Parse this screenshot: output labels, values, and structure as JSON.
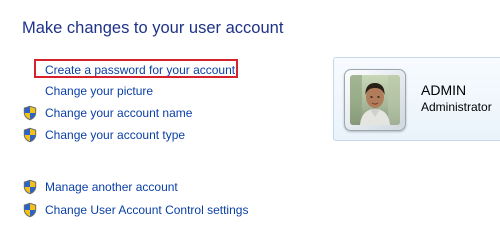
{
  "page": {
    "title": "Make changes to your user account"
  },
  "tasks": [
    {
      "label": "Create a password for your account",
      "icon": "none",
      "highlighted": true
    },
    {
      "label": "Change your picture",
      "icon": "none"
    },
    {
      "label": "Change your account name",
      "icon": "uac-shield-icon"
    },
    {
      "label": "Change your account type",
      "icon": "uac-shield-icon"
    },
    {
      "label": "Manage another account",
      "icon": "uac-shield-icon"
    },
    {
      "label": "Change User Account Control settings",
      "icon": "uac-shield-icon"
    }
  ],
  "account": {
    "name": "ADMIN",
    "type": "Administrator"
  },
  "colors": {
    "title": "#1e3287",
    "link": "#0a3fa6",
    "highlight_border": "#d5222c"
  }
}
